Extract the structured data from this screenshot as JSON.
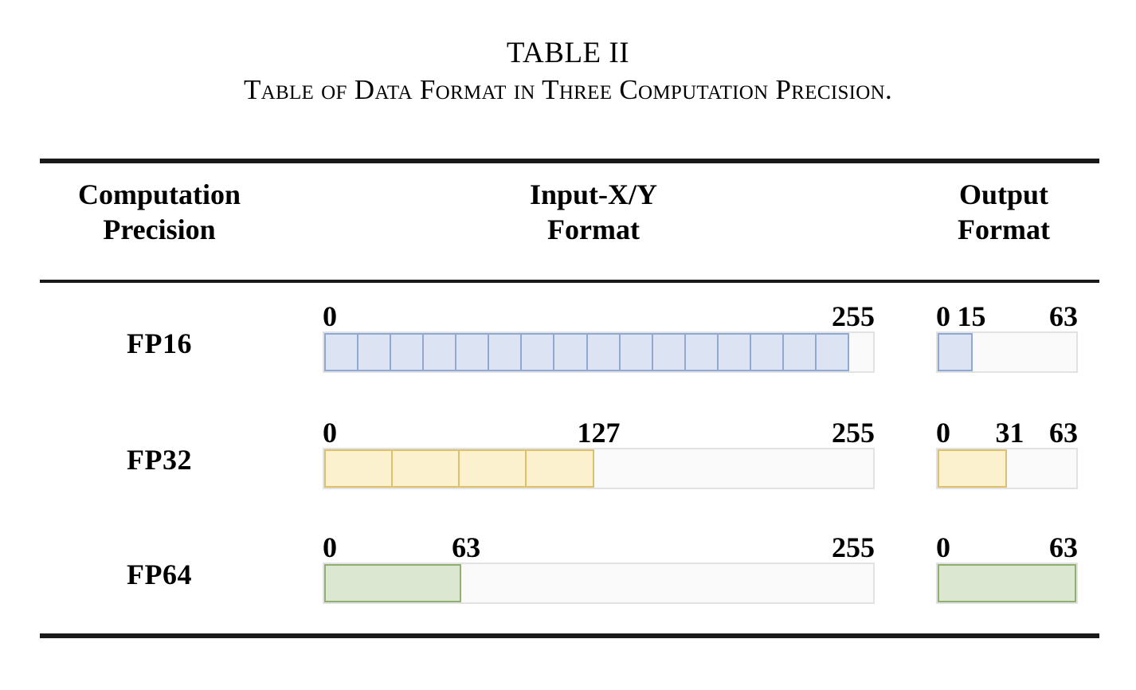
{
  "caption": {
    "table_number": "TABLE II",
    "title": "Table of Data Format in Three Computation Precision."
  },
  "header": {
    "col1_line1": "Computation",
    "col1_line2": "Precision",
    "col2_line1": "Input-X/Y",
    "col2_line2": "Format",
    "col3_line1": "Output",
    "col3_line2": "Format"
  },
  "colors": {
    "fp16_fill": "#dce3f3",
    "fp16_border": "#8fa8d4",
    "fp32_fill": "#fbf1cf",
    "fp32_border": "#ddc06a",
    "fp64_fill": "#dbe7d0",
    "fp64_border": "#8fb070",
    "empty_fill": "#fafafa",
    "empty_border": "#e2e2e2",
    "rule": "#1a1a1a"
  },
  "rows": [
    {
      "precision": "FP16",
      "input": {
        "tick_left": "0",
        "tick_mid": "",
        "tick_right": "255",
        "range_max": 255,
        "filled_to": 255,
        "fill_percent": 100,
        "segments": 16,
        "segment_width_bits": 16
      },
      "output": {
        "tick_left": "0",
        "tick_mid": "15",
        "tick_right": "63",
        "range_max": 63,
        "filled_to": 15,
        "fill_percent": 25,
        "segments": 1
      }
    },
    {
      "precision": "FP32",
      "input": {
        "tick_left": "0",
        "tick_mid": "127",
        "tick_right": "255",
        "range_max": 255,
        "filled_to": 127,
        "fill_percent": 50,
        "segments": 4,
        "segment_width_bits": 32
      },
      "output": {
        "tick_left": "0",
        "tick_mid": "31",
        "tick_right": "63",
        "range_max": 63,
        "filled_to": 31,
        "fill_percent": 50,
        "segments": 1
      }
    },
    {
      "precision": "FP64",
      "input": {
        "tick_left": "0",
        "tick_mid": "63",
        "tick_right": "255",
        "range_max": 255,
        "filled_to": 63,
        "fill_percent": 25,
        "segments": 1,
        "segment_width_bits": 64
      },
      "output": {
        "tick_left": "0",
        "tick_mid": "",
        "tick_right": "63",
        "range_max": 63,
        "filled_to": 63,
        "fill_percent": 100,
        "segments": 1
      }
    }
  ]
}
